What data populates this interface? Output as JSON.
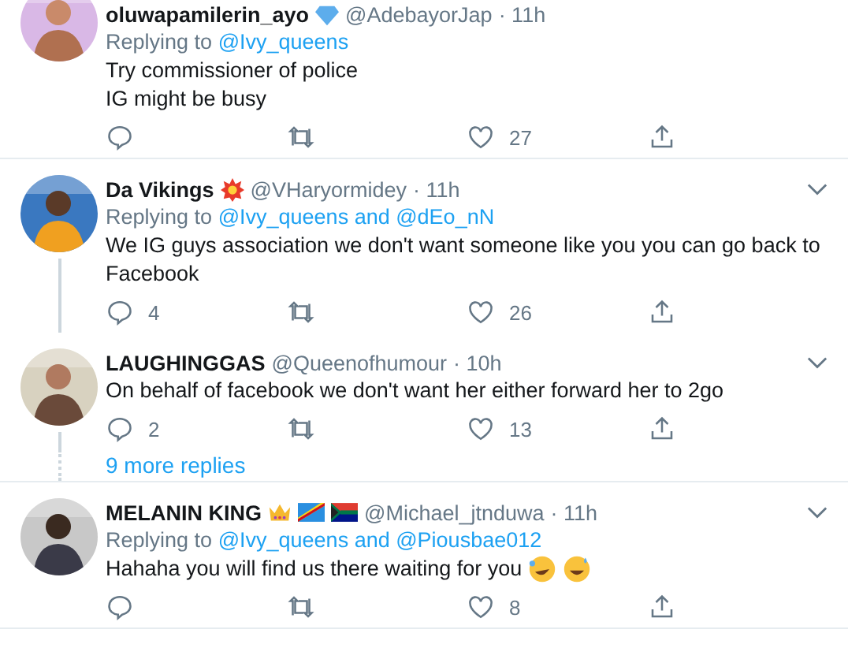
{
  "threads": [
    {
      "tweets": [
        {
          "name": "oluwapamilerin_ayo",
          "emojis": [
            {
              "kind": "diamond"
            }
          ],
          "handle": "@AdebayorJap",
          "time": "· 11h",
          "menu": false,
          "replying_label": "Replying to",
          "replying_to": "@Ivy_queens",
          "text": "Try commissioner of police\nIG might be busy",
          "likes": "27"
        }
      ]
    },
    {
      "tweets": [
        {
          "name": "Da Vikings",
          "emojis": [
            {
              "kind": "explosion"
            }
          ],
          "handle": "@VHaryormidey",
          "time": "· 11h",
          "menu": true,
          "replying_label": "Replying to",
          "replying_to": "@Ivy_queens and @dEo_nN",
          "text": "We IG guys association we don't want someone like you you can go back to Facebook",
          "replies": "4",
          "likes": "26"
        },
        {
          "name": "LAUGHINGGAS",
          "handle": "@Queenofhumour",
          "time": "· 10h",
          "menu": true,
          "text": "On behalf of facebook we don't want her either forward her to 2go",
          "replies": "2",
          "likes": "13"
        }
      ],
      "more_replies": "9 more replies"
    },
    {
      "tweets": [
        {
          "name": "MELANIN KING",
          "emojis": [
            {
              "kind": "crown"
            },
            {
              "kind": "flag_cd"
            },
            {
              "kind": "flag_za"
            }
          ],
          "handle": "@Michael_jtnduwa",
          "time": "· 11h",
          "menu": true,
          "replying_label": "Replying to",
          "replying_to": "@Ivy_queens and @Piousbae012",
          "text": "Hahaha you will find us there waiting for you",
          "text_emojis": [
            {
              "kind": "rofl"
            },
            {
              "kind": "sweat_smile"
            }
          ],
          "likes": "8"
        }
      ]
    }
  ]
}
